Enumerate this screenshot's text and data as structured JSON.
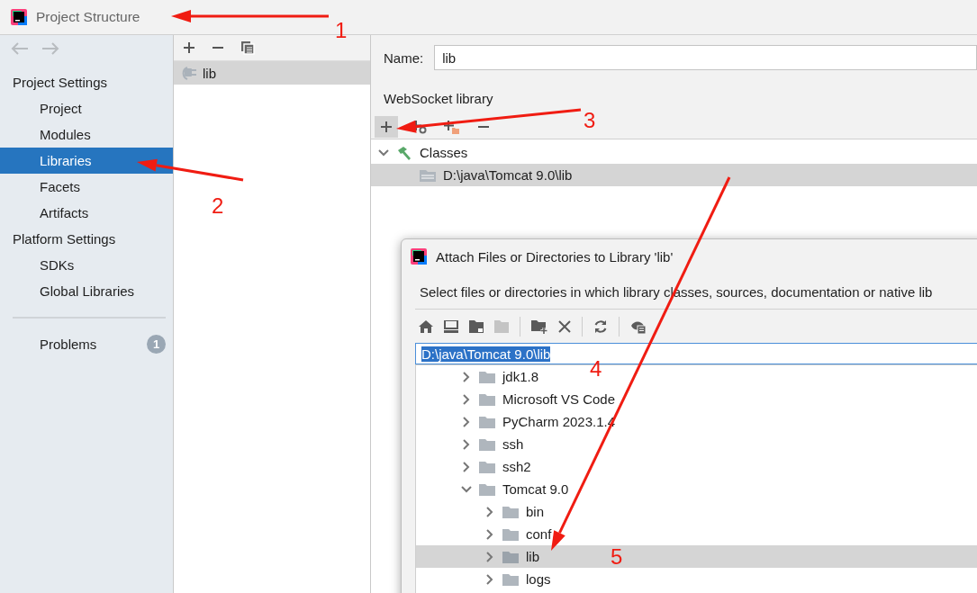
{
  "window": {
    "title": "Project Structure"
  },
  "sidebar": {
    "groups": [
      {
        "heading": "Project Settings",
        "items": [
          {
            "label": "Project",
            "selected": false
          },
          {
            "label": "Modules",
            "selected": false
          },
          {
            "label": "Libraries",
            "selected": true
          },
          {
            "label": "Facets",
            "selected": false
          },
          {
            "label": "Artifacts",
            "selected": false
          }
        ]
      },
      {
        "heading": "Platform Settings",
        "items": [
          {
            "label": "SDKs",
            "selected": false
          },
          {
            "label": "Global Libraries",
            "selected": false
          }
        ]
      }
    ],
    "problems": {
      "label": "Problems",
      "count": "1"
    }
  },
  "libraries": {
    "items": [
      {
        "label": "lib",
        "selected": true
      }
    ]
  },
  "detail": {
    "name_label": "Name:",
    "name_value": "lib",
    "library_type": "WebSocket library",
    "tree": [
      {
        "label": "Classes",
        "expanded": true,
        "selected": false,
        "children": [
          {
            "label": "D:\\java\\Tomcat 9.0\\lib",
            "selected": true
          }
        ]
      }
    ]
  },
  "dialog": {
    "title": "Attach Files or Directories to Library 'lib'",
    "description": "Select files or directories in which library classes, sources, documentation or native lib",
    "path": "D:\\java\\Tomcat 9.0\\lib",
    "tree": [
      {
        "label": "jdk1.8",
        "expanded": false,
        "selected": false
      },
      {
        "label": "Microsoft VS Code",
        "expanded": false,
        "selected": false
      },
      {
        "label": "PyCharm 2023.1.4",
        "expanded": false,
        "selected": false
      },
      {
        "label": "ssh",
        "expanded": false,
        "selected": false
      },
      {
        "label": "ssh2",
        "expanded": false,
        "selected": false
      },
      {
        "label": "Tomcat 9.0",
        "expanded": true,
        "selected": false,
        "children": [
          {
            "label": "bin",
            "expanded": false,
            "selected": false
          },
          {
            "label": "conf",
            "expanded": false,
            "selected": false
          },
          {
            "label": "lib",
            "expanded": false,
            "selected": true
          },
          {
            "label": "logs",
            "expanded": false,
            "selected": false
          }
        ]
      }
    ]
  },
  "annotations": [
    {
      "label": "1"
    },
    {
      "label": "2"
    },
    {
      "label": "3"
    },
    {
      "label": "4"
    },
    {
      "label": "5"
    }
  ]
}
